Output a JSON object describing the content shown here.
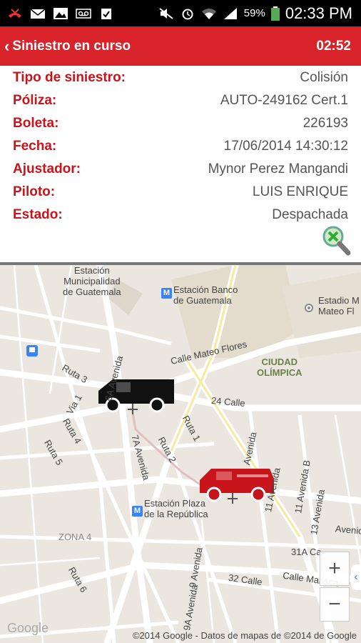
{
  "status_bar": {
    "icons_left": [
      "missed-call-icon",
      "email-icon",
      "picture-icon",
      "voicemail-icon",
      "clipboard-check-icon"
    ],
    "icons_right": [
      "mute-icon",
      "alarm-icon",
      "wifi-icon",
      "signal-icon"
    ],
    "battery": "59%",
    "time": "02:33 PM"
  },
  "action_bar": {
    "back_label": "Siniestro en curso",
    "timer": "02:52",
    "color": "#d8232a"
  },
  "details": {
    "label_color": "#c8141b",
    "rows": [
      {
        "label": "Tipo de siniestro:",
        "value": "Colisión"
      },
      {
        "label": "Póliza:",
        "value": "AUTO-249162 Cert.1"
      },
      {
        "label": "Boleta:",
        "value": "226193"
      },
      {
        "label": "Fecha:",
        "value": "17/06/2014 14:30:12"
      },
      {
        "label": "Ajustador:",
        "value": "Mynor Perez Mangandi"
      },
      {
        "label": "Piloto:",
        "value": "LUIS ENRIQUE"
      },
      {
        "label": "Estado:",
        "value": "Despachada"
      }
    ]
  },
  "map": {
    "labels": {
      "estacion_municipalidad": "Estación\nMunicipalidad\nde Guatemala",
      "estacion_banco": "Estación Banco\nde Guatemala",
      "estadio": "Estadio M\nMateo Fl",
      "calle_mateo": "Calle Mateo Flores",
      "ciudad_olimpica": "CIUDAD\nOLÍMPICA",
      "calle24": "24 Calle",
      "ruta3": "Ruta 3",
      "avenida6a": "6A Avenida",
      "via1": "Via 1",
      "ruta4": "Ruta 4",
      "ruta5": "Ruta 5",
      "avenida7a": "7A Avenida",
      "ruta1": "Ruta 1",
      "ruta2": "Ruta 2",
      "avenida_v": "Avenida",
      "avenida11": "11 Avenida",
      "avenida11b": "11 Avenida B",
      "avenida13": "13 Avenida",
      "avenida_e": "Avenid",
      "estacion_plaza": "Estación Plaza\nde la República",
      "zona4": "ZONA 4",
      "ruta6": "Ruta 6",
      "avenida9": "9 Avenida",
      "calle32": "32 Calle",
      "calle31a": "31A Ca",
      "calle_marisca": "Calle Marisca",
      "avenida9a": "9A Avenida"
    },
    "zoom_in": "+",
    "zoom_out": "−",
    "google_logo": "Google",
    "attribution": "©2014 Google - Datos de mapas de ©2014 de Google",
    "vehicles": [
      {
        "name": "adjuster-van",
        "color": "#111111"
      },
      {
        "name": "incident-van",
        "color": "#c8141b"
      }
    ]
  }
}
